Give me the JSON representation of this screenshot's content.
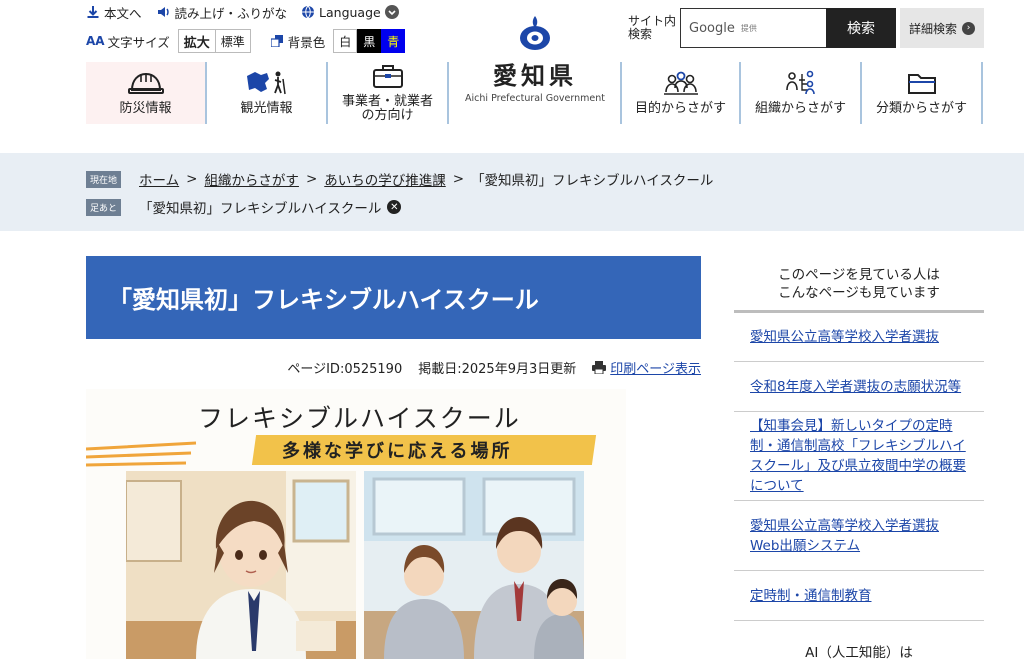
{
  "header": {
    "util": {
      "honbun": "本文へ",
      "yomiage": "読み上げ・ふりがな",
      "language": "Language",
      "fontsize_label": "文字サイズ",
      "fontsize_large": "拡大",
      "fontsize_normal": "標準",
      "bg_label": "背景色",
      "bg_white": "白",
      "bg_black": "黒",
      "bg_blue": "青"
    },
    "search": {
      "label": "サイト内検索",
      "google": "Google",
      "provided": "提供",
      "button": "検索",
      "advanced": "詳細検索"
    },
    "logo": {
      "jp": "愛知県",
      "en": "Aichi Prefectural Government"
    },
    "nav_left": [
      {
        "label": "防災情報",
        "icon": "helmet-icon"
      },
      {
        "label": "観光情報",
        "icon": "tourism-icon"
      },
      {
        "label": "事業者・就業者の方向け",
        "icon": "briefcase-icon"
      }
    ],
    "nav_right": [
      {
        "label": "目的からさがす",
        "icon": "people-icon"
      },
      {
        "label": "組織からさがす",
        "icon": "org-icon"
      },
      {
        "label": "分類からさがす",
        "icon": "folder-icon"
      }
    ]
  },
  "breadcrumb": {
    "current_tag": "現在地",
    "items": [
      "ホーム",
      "組織からさがす",
      "あいちの学び推進課",
      "「愛知県初」フレキシブルハイスクール"
    ],
    "history_tag": "足あと",
    "history": "「愛知県初」フレキシブルハイスクール"
  },
  "main": {
    "title": "「愛知県初」フレキシブルハイスクール",
    "page_id": "ページID:0525190",
    "date": "掲載日:2025年9月3日更新",
    "print": "印刷ページ表示",
    "hero": {
      "title": "フレキシブルハイスクール",
      "subtitle": "多様な学びに応える場所"
    }
  },
  "sidebar": {
    "heading_1": "このページを見ている人は",
    "heading_2": "こんなページも見ています",
    "links": [
      "愛知県公立高等学校入学者選抜",
      "令和8年度入学者選抜の志願状況等",
      "【知事会見】新しいタイプの定時制・通信制高校「フレキシブルハイスクール」及び県立夜間中学の概要について",
      "愛知県公立高等学校入学者選抜Web出願システム",
      "定時制・通信制教育"
    ],
    "ai_heading": "AI（人工知能）は"
  },
  "colors": {
    "title_bar": "#3466b8",
    "link": "#1c46a8",
    "crumb_band": "#e8eef4",
    "nav_divider": "#a9c4de",
    "bg_blue_btn": "#0000ee"
  }
}
